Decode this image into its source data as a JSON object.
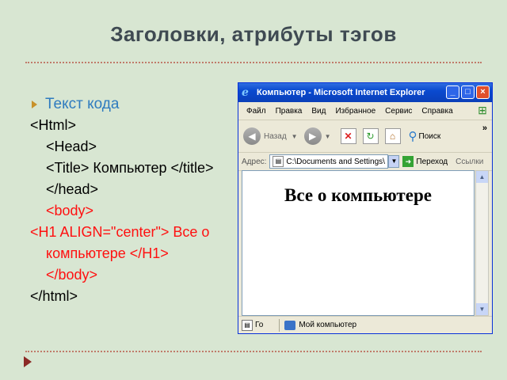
{
  "slide": {
    "title": "Заголовки, атрибуты тэгов",
    "bullet_heading": "Текст кода",
    "code_lines": [
      "<Html>",
      "<Head>",
      "<Title> Компьютер </title>",
      "</head>",
      "<body>",
      "<H1 ALIGN=\"center\"> Все о компьютере </H1>",
      "</body>",
      "</html>"
    ]
  },
  "browser": {
    "window_title": "Компьютер - Microsoft Internet Explorer",
    "menu": [
      "Файл",
      "Правка",
      "Вид",
      "Избранное",
      "Сервис",
      "Справка"
    ],
    "back_label": "Назад",
    "search_label": "Поиск",
    "address_label": "Адрес:",
    "address_value": "C:\\Documents and Settings\\",
    "go_label": "Переход",
    "links_label": "Ссылки",
    "page_heading": "Все о компьютере",
    "status_text": "Го",
    "zone_text": "Мой компьютер"
  },
  "colors": {
    "background": "#d8e6d2",
    "title": "#3f4a52",
    "bullet_heading": "#2e7bbf",
    "code_black": "#000000",
    "code_red": "#ff1010",
    "bullet": "#c8912b",
    "nav_arrow": "#8b2a26"
  }
}
